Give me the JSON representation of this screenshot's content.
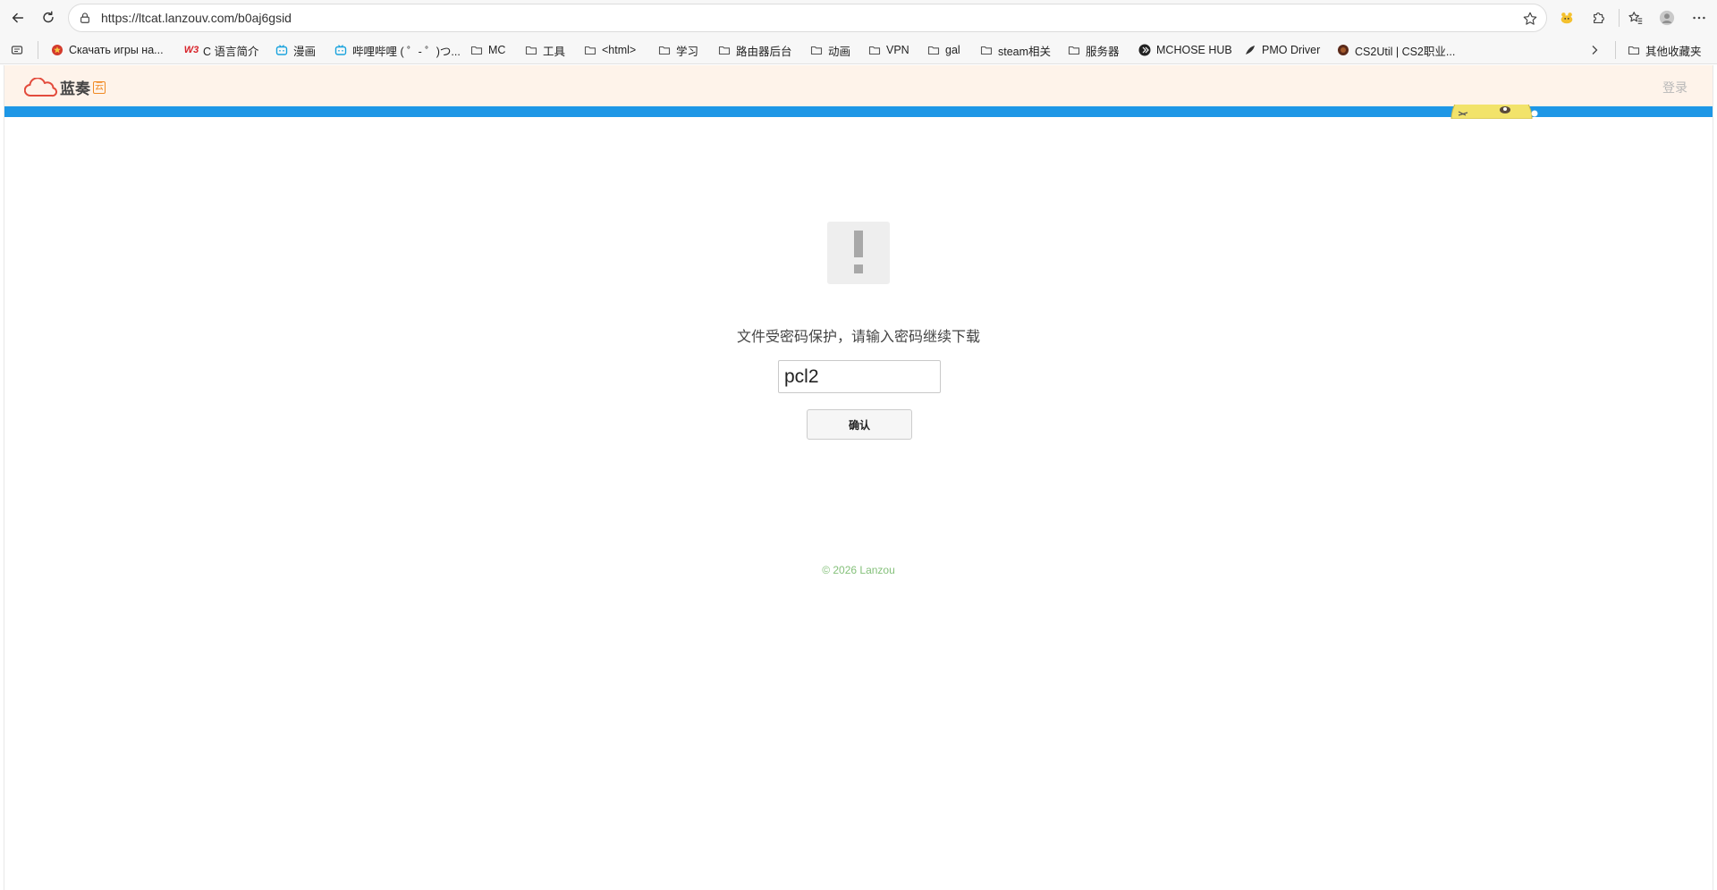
{
  "browser": {
    "url": "https://ltcat.lanzouv.com/b0aj6gsid",
    "icons": {
      "back": "back-arrow-icon",
      "reload": "reload-icon",
      "lock": "lock-icon",
      "favorite": "star-icon",
      "extension_pet": "pet-extension-icon",
      "extensions": "puzzle-icon",
      "favorites_list": "favorites-icon",
      "profile": "avatar-icon",
      "menu": "more-icon"
    }
  },
  "bookmarks": {
    "items": [
      {
        "label": "Скачать игры на...",
        "icon": "game-site-icon"
      },
      {
        "label": "C 语言简介",
        "icon": "w3-icon",
        "badge": "W3"
      },
      {
        "label": "漫画",
        "icon": "bilibili-icon"
      },
      {
        "label": "哔哩哔哩 ( ゜- ゜)つ...",
        "icon": "bilibili-icon"
      },
      {
        "label": "MC",
        "icon": "folder-icon"
      },
      {
        "label": "工具",
        "icon": "folder-icon"
      },
      {
        "label": "<html>",
        "icon": "folder-icon"
      },
      {
        "label": "学习",
        "icon": "folder-icon"
      },
      {
        "label": "路由器后台",
        "icon": "folder-icon"
      },
      {
        "label": "动画",
        "icon": "folder-icon"
      },
      {
        "label": "VPN",
        "icon": "folder-icon"
      },
      {
        "label": "gal",
        "icon": "folder-icon"
      },
      {
        "label": "steam相关",
        "icon": "folder-icon"
      },
      {
        "label": "服务器",
        "icon": "folder-icon"
      },
      {
        "label": "MCHOSE HUB",
        "icon": "mchose-icon"
      },
      {
        "label": "PMO Driver",
        "icon": "pmo-icon"
      },
      {
        "label": "CS2Util | CS2职业...",
        "icon": "cs2-icon"
      }
    ],
    "other": "其他收藏夹"
  },
  "site": {
    "logo_text": "蓝奏",
    "logo_badge": "云",
    "login": "登录",
    "prompt": "文件受密码保护，请输入密码继续下载",
    "password_value": "pcl2",
    "confirm_label": "确认",
    "footer": "© 2026 Lanzou"
  },
  "colors": {
    "header_bg": "#fef3ea",
    "band": "#1e97e6",
    "footer_text": "#84c07a",
    "logo_accent": "#f08a24"
  }
}
